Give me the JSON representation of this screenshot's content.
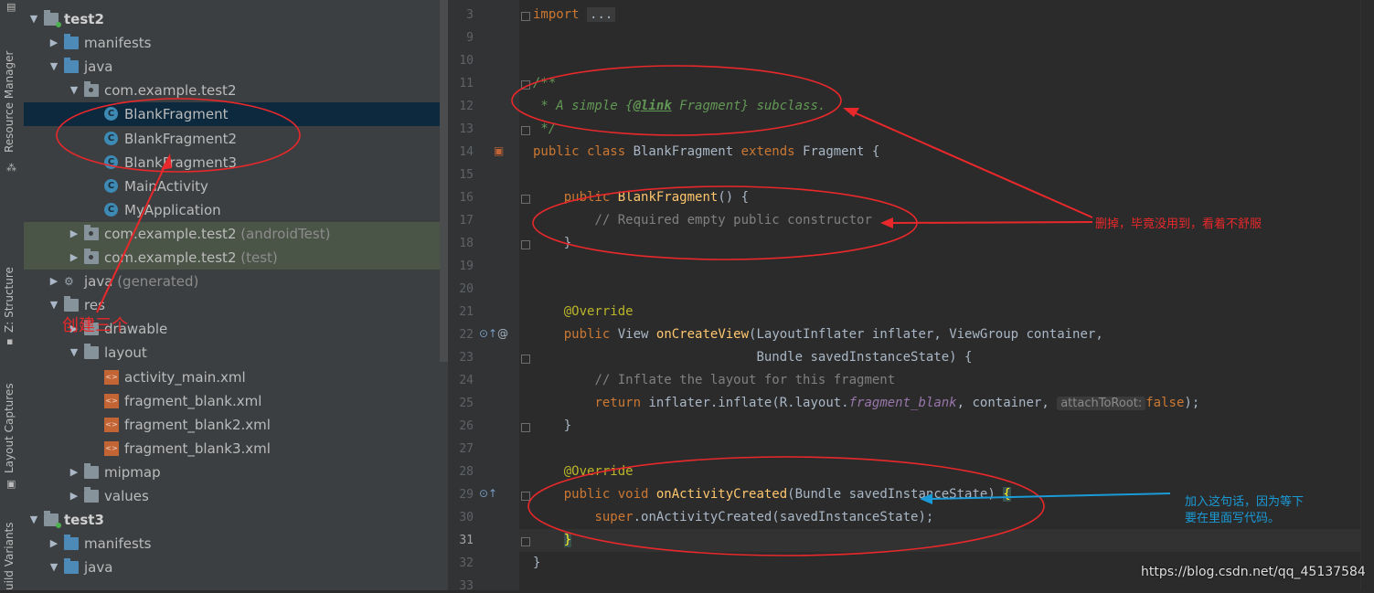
{
  "side_tabs": [
    "Resource Manager",
    "Z: Structure",
    "Layout Captures",
    "uild Variants"
  ],
  "tree": [
    {
      "label": "test2",
      "type": "module",
      "expanded": true
    },
    {
      "label": "manifests",
      "type": "folder-blue",
      "expanded": false
    },
    {
      "label": "java",
      "type": "folder-blue",
      "expanded": true
    },
    {
      "label": "com.example.test2",
      "type": "package",
      "expanded": true
    },
    {
      "label": "BlankFragment",
      "type": "class",
      "selected": true
    },
    {
      "label": "BlankFragment2",
      "type": "class"
    },
    {
      "label": "BlankFragment3",
      "type": "class"
    },
    {
      "label": "MainActivity",
      "type": "class"
    },
    {
      "label": "MyApplication",
      "type": "class"
    },
    {
      "label": "com.example.test2",
      "suffix": "(androidTest)",
      "type": "package",
      "expanded": false
    },
    {
      "label": "com.example.test2",
      "suffix": "(test)",
      "type": "package",
      "expanded": false
    },
    {
      "label": "java",
      "suffix": "(generated)",
      "type": "generated",
      "expanded": false
    },
    {
      "label": "res",
      "type": "res",
      "expanded": true
    },
    {
      "label": "drawable",
      "type": "folder",
      "expanded": false
    },
    {
      "label": "layout",
      "type": "folder",
      "expanded": true
    },
    {
      "label": "activity_main.xml",
      "type": "xml"
    },
    {
      "label": "fragment_blank.xml",
      "type": "xml"
    },
    {
      "label": "fragment_blank2.xml",
      "type": "xml"
    },
    {
      "label": "fragment_blank3.xml",
      "type": "xml"
    },
    {
      "label": "mipmap",
      "type": "folder",
      "expanded": false
    },
    {
      "label": "values",
      "type": "folder",
      "expanded": false
    },
    {
      "label": "test3",
      "type": "module",
      "expanded": true
    },
    {
      "label": "manifests",
      "type": "folder-blue",
      "expanded": false
    },
    {
      "label": "java",
      "type": "folder-blue",
      "expanded": true
    }
  ],
  "editor": {
    "line_numbers": [
      "3",
      "9",
      "10",
      "11",
      "12",
      "13",
      "14",
      "15",
      "16",
      "17",
      "18",
      "19",
      "20",
      "21",
      "22",
      "23",
      "24",
      "25",
      "26",
      "27",
      "28",
      "29",
      "30",
      "31",
      "32",
      "33"
    ],
    "current_line": "31",
    "lines": {
      "import_kw": "import",
      "import_fold": "...",
      "doc_open": "/**",
      "doc_mid_a": " * A simple {",
      "doc_tag": "@link",
      "doc_mid_b": " Fragment} subclass.",
      "doc_close": " */",
      "class_kw": "public class ",
      "class_name": "BlankFragment ",
      "extends_kw": "extends ",
      "class_tail": "Fragment {",
      "ctor_kw": "public ",
      "ctor_name": "BlankFragment",
      "ctor_tail": "() {",
      "ctor_comment": "// Required empty public constructor",
      "close_brace": "}",
      "override": "@Override",
      "ocv_kw": "public ",
      "ocv_type": "View ",
      "ocv_name": "onCreateView",
      "ocv_params": "(LayoutInflater inflater, ViewGroup container,",
      "ocv_params2": "Bundle savedInstanceState) {",
      "inflate_comment": "// Inflate the layout for this fragment",
      "return_kw": "return ",
      "inflate_a": "inflater.inflate(R.layout.",
      "inflate_field": "fragment_blank",
      "inflate_b": ", container, ",
      "inflate_hint": "attachToRoot:",
      "inflate_false": "false",
      "inflate_end": ");",
      "oac_kw": "public void ",
      "oac_name": "onActivityCreated",
      "oac_params": "(Bundle savedInstanceState) ",
      "oac_brace": "{",
      "super_kw": "super",
      "super_call": ".onActivityCreated(savedInstanceState);"
    }
  },
  "annotations": {
    "create_three": "创建三个",
    "delete_note": "删掉，毕竟没用到，看着不舒服",
    "add_note_1": "加入这句话，因为等下",
    "add_note_2": "要在里面写代码。",
    "red": "#e8282b",
    "blue": "#1a9ad6"
  },
  "watermark": "https://blog.csdn.net/qq_45137584",
  "colors": {
    "keyword": "#cc7832",
    "function": "#ffc66d",
    "comment": "#808080",
    "doc": "#629755",
    "annotation": "#bbb529",
    "field": "#9876aa"
  }
}
